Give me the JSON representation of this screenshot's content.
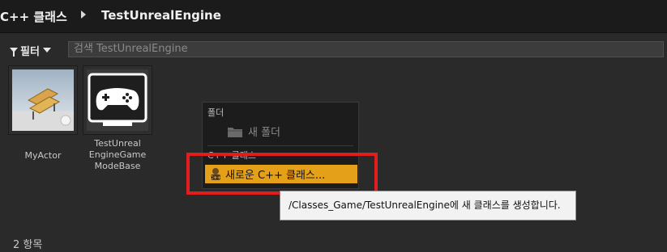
{
  "breadcrumb": {
    "root": "C++ 클래스",
    "current": "TestUnrealEngine"
  },
  "toolbar": {
    "filter_label": "필터",
    "search_placeholder": "검색 TestUnrealEngine"
  },
  "assets": [
    {
      "label": "MyActor",
      "icon": "actor-bench-thumbnail"
    },
    {
      "label": "TestUnreal EngineGame ModeBase",
      "lines": [
        "TestUnreal",
        "EngineGame",
        "ModeBase"
      ],
      "icon": "gamepad-thumbnail"
    }
  ],
  "footer": {
    "item_count": "2 항목"
  },
  "context_menu": {
    "folder_section": "폴더",
    "new_folder": "새 폴더",
    "cpp_section": "C++ 클래스",
    "new_cpp_class": "새로운 C++ 클래스..."
  },
  "tooltip": {
    "text": "/Classes_Game/TestUnrealEngine에 새 클래스를 생성합니다."
  },
  "colors": {
    "accent": "#e5a01a",
    "highlight_box": "#e31d1d"
  }
}
